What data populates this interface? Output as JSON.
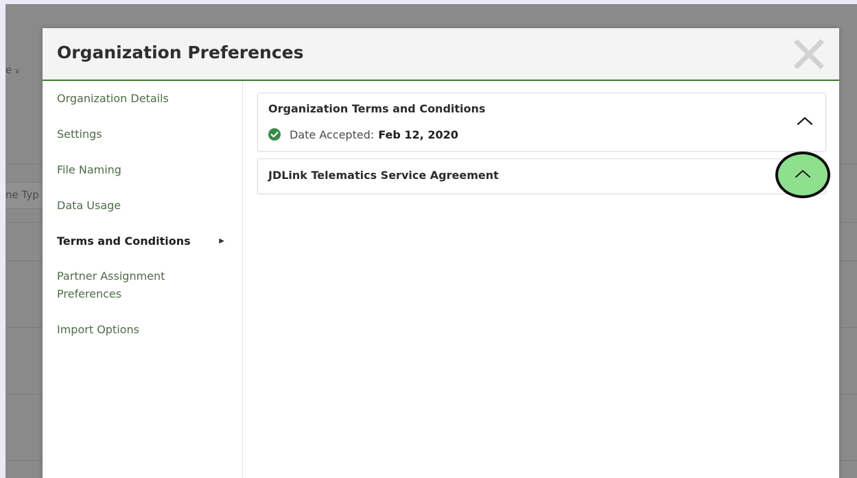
{
  "background": {
    "partial_dropdown_text": "e",
    "partial_column_header": "ne Typ"
  },
  "modal": {
    "title": "Organization Preferences",
    "close_icon": "close-x-icon"
  },
  "sidebar": {
    "items": [
      {
        "label": "Organization Details",
        "active": false
      },
      {
        "label": "Settings",
        "active": false
      },
      {
        "label": "File Naming",
        "active": false
      },
      {
        "label": "Data Usage",
        "active": false
      },
      {
        "label": "Terms and Conditions",
        "active": true
      },
      {
        "label": "Partner Assignment Preferences",
        "active": false
      },
      {
        "label": "Import Options",
        "active": false
      }
    ],
    "active_indicator_icon": "caret-right-icon"
  },
  "panels": [
    {
      "title": "Organization Terms and Conditions",
      "date_label": "Date Accepted:",
      "date_value": "Feb 12, 2020",
      "status_icon": "check-circle-icon",
      "toggle_icon": "chevron-up-icon"
    },
    {
      "title": "JDLink Telematics Service Agreement",
      "toggle_icon": "chevron-up-icon"
    }
  ],
  "colors": {
    "accent": "#3b7d2a",
    "nav_link": "#4f6b49",
    "check": "#3a8a4a",
    "highlight": "#8ee08e"
  }
}
